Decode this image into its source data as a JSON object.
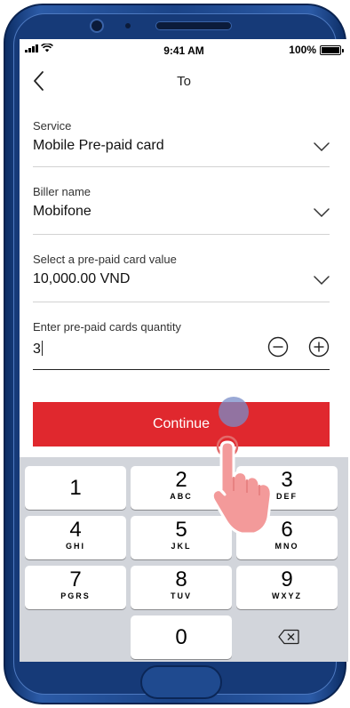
{
  "status_bar": {
    "time": "9:41 AM",
    "battery": "100%"
  },
  "nav": {
    "title": "To"
  },
  "form": {
    "service": {
      "label": "Service",
      "value": "Mobile Pre-paid card"
    },
    "biller": {
      "label": "Biller name",
      "value": "Mobifone"
    },
    "card_value": {
      "label": "Select a pre-paid card value",
      "value": "10,000.00 VND"
    },
    "quantity": {
      "label": "Enter pre-paid cards quantity",
      "value": "3"
    }
  },
  "continue_label": "Continue",
  "keypad": {
    "keys": [
      {
        "digit": "1",
        "letters": ""
      },
      {
        "digit": "2",
        "letters": "ABC"
      },
      {
        "digit": "3",
        "letters": "DEF"
      },
      {
        "digit": "4",
        "letters": "GHI"
      },
      {
        "digit": "5",
        "letters": "JKL"
      },
      {
        "digit": "6",
        "letters": "MNO"
      },
      {
        "digit": "7",
        "letters": "PGRS"
      },
      {
        "digit": "8",
        "letters": "TUV"
      },
      {
        "digit": "9",
        "letters": "WXYZ"
      }
    ],
    "zero": "0"
  },
  "colors": {
    "accent": "#e0282e",
    "phone_frame": "#1b4488",
    "keypad_bg": "#d2d5db"
  },
  "icons": [
    "back-chevron-icon",
    "chevron-down-icon",
    "minus-circle-icon",
    "plus-circle-icon",
    "delete-backspace-icon",
    "tap-hand-icon"
  ]
}
